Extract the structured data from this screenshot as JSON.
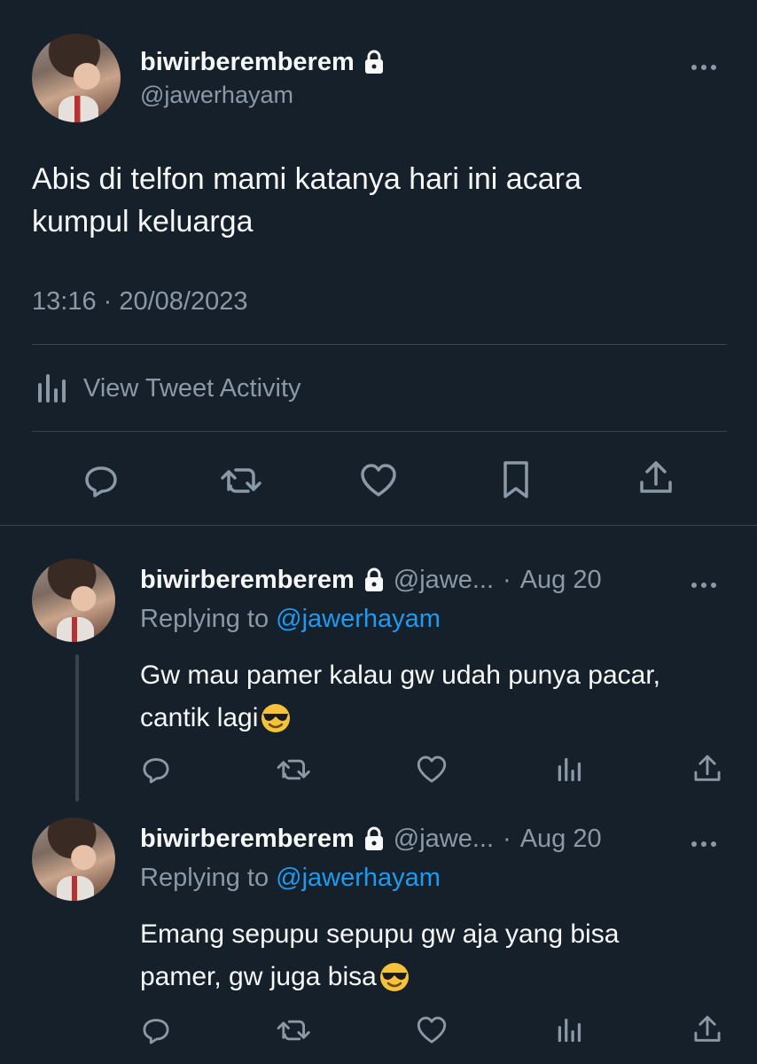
{
  "main_tweet": {
    "display_name": "biwirberemberem",
    "handle": "@jawerhayam",
    "text_line1": "Abis di telfon mami katanya hari ini acara",
    "text_line2": "kumpul keluarga",
    "timestamp": "13:16 · 20/08/2023",
    "activity_label": "View Tweet Activity"
  },
  "replies": [
    {
      "display_name": "biwirberemberem",
      "handle_trunc": "@jawe...",
      "dot": "·",
      "date": "Aug 20",
      "replying_prefix": "Replying to",
      "replying_to": "@jawerhayam",
      "text_line1": "Gw mau pamer kalau gw udah punya pacar,",
      "text_line2": "cantik lagi"
    },
    {
      "display_name": "biwirberemberem",
      "handle_trunc": "@jawe...",
      "dot": "·",
      "date": "Aug 20",
      "replying_prefix": "Replying to",
      "replying_to": "@jawerhayam",
      "text_line1": "Emang sepupu sepupu gw aja yang bisa",
      "text_line2": "pamer, gw juga bisa"
    }
  ],
  "colors": {
    "background": "#15202b",
    "text": "#f7f9f9",
    "muted": "#8b98a5",
    "link": "#1d9bf0",
    "divider": "#38444d"
  },
  "icons": [
    "lock-icon",
    "more-icon",
    "analytics-icon",
    "reply-icon",
    "retweet-icon",
    "like-icon",
    "bookmark-icon",
    "share-icon",
    "cool-emoji"
  ]
}
